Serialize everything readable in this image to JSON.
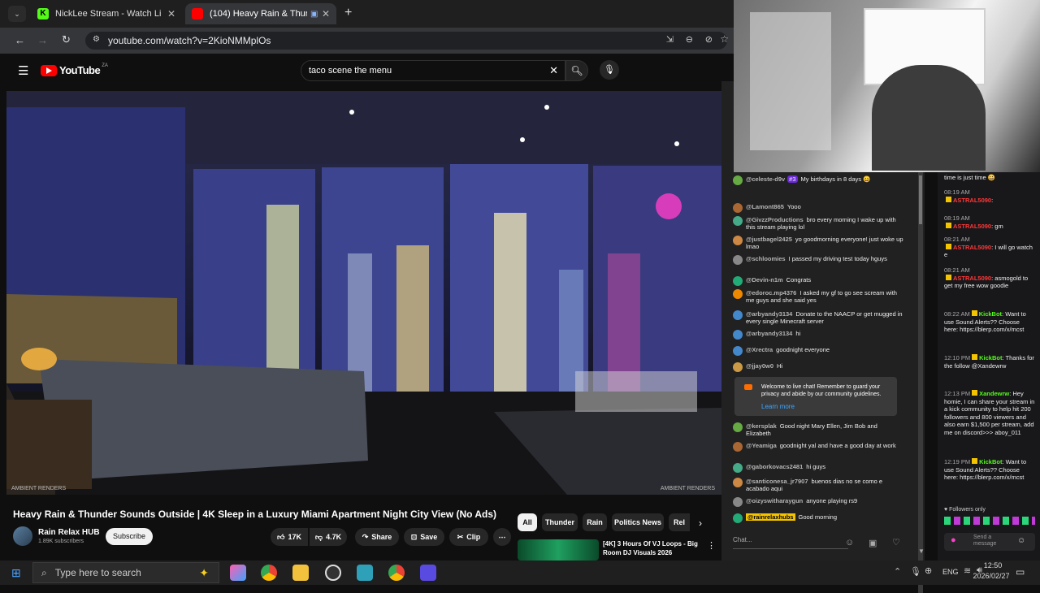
{
  "browser": {
    "tabs": [
      {
        "label": "NickLee Stream - Watch Live on"
      },
      {
        "label": "(104) Heavy Rain & Thunde"
      }
    ],
    "url": "youtube.com/watch?v=2KioNMMplOs"
  },
  "youtube": {
    "logo": "YouTube",
    "logo_sup": "ZA",
    "search_value": "taco scene the menu",
    "video_watermark_left": "AMBIENT RENDERS",
    "video_watermark_right": "AMBIENT RENDERS",
    "title": "Heavy Rain & Thunder Sounds Outside | 4K Sleep in a Luxury Miami Apartment Night City View (No Ads)",
    "channel": "Rain Relax HUB",
    "subscribers": "1.89K subscribers",
    "subscribe_label": "Subscribe",
    "likes": "17K",
    "dislikes": "4.7K",
    "share_label": "Share",
    "save_label": "Save",
    "clip_label": "Clip",
    "chips": [
      "All",
      "Thunder",
      "Rain",
      "Politics News",
      "Rel"
    ],
    "rec_title": "[4K] 3 Hours Of VJ Loops - Big Room DJ Visuals 2026"
  },
  "live_chat": {
    "messages": [
      {
        "user": "@celeste-d9v",
        "badge": "#3",
        "text": "My birthdays in 8 days 😀"
      },
      {
        "user": "@Lamont865",
        "text": "Yooo"
      },
      {
        "user": "@GivzzProductions",
        "text": "bro every morning I wake up with this stream playing lol"
      },
      {
        "user": "@justbagel2425",
        "text": "yo goodmorning everyone! just woke up lmao"
      },
      {
        "user": "@schloomies",
        "text": "I passed my driving test today hguys"
      },
      {
        "user": "@Devin-n1m",
        "text": "Congrats"
      },
      {
        "user": "@edoroc.mp4376",
        "text": "I asked my gf to go see scream with me guys and she said yes"
      },
      {
        "user": "@arbyandy3134",
        "text": "Donate to the NAACP or get mugged in every single Minecraft server"
      },
      {
        "user": "@arbyandy3134",
        "text": "hi"
      },
      {
        "user": "@Xrectra",
        "text": "goodnight everyone"
      },
      {
        "user": "@jjay0w0",
        "text": "Hi"
      }
    ],
    "notice_text": "Welcome to live chat! Remember to guard your privacy and abide by our community guidelines.",
    "notice_link": "Learn more",
    "messages2": [
      {
        "user": "@kersplak",
        "text": "Good night Mary Ellen, Jim Bob and Elizabeth"
      },
      {
        "user": "@Yeamiga",
        "text": "goodnight yal and have a good day at work"
      },
      {
        "user": "@gaborkovacs2481",
        "text": "hi guys"
      },
      {
        "user": "@santiconesa_jr7907",
        "text": "buenos dias no se como e acabado aqui"
      },
      {
        "user": "@oizyswitharaygun",
        "text": "anyone playing rs9"
      },
      {
        "user": "@rainrelaxhubs",
        "text": "Good morning"
      }
    ],
    "input_placeholder": "Chat..."
  },
  "kick_chat": {
    "top_text": "time is just time 😀",
    "messages": [
      {
        "time": "08:19 AM",
        "user": "ASTRAL5090",
        "text": ":"
      },
      {
        "time": "08:19 AM",
        "user": "ASTRAL5090",
        "text": ": gm"
      },
      {
        "time": "08:21 AM",
        "user": "ASTRAL5090",
        "text": ": I will go watch e"
      },
      {
        "time": "08:21 AM",
        "user": "ASTRAL5090",
        "text": ": asmogold to get my free wow goodie"
      },
      {
        "time": "08:22 AM",
        "user": "KickBot",
        "text": ": Want to use Sound Alerts?? Choose here: https://blerp.com/x/mcst"
      },
      {
        "time": "12:10 PM",
        "user": "KickBot",
        "text": ": Thanks for the follow @Xandewrw"
      },
      {
        "time": "12:13 PM",
        "user": "Xandewrw",
        "text": ": Hey homie, I can share your stream in a kick community to help hit 200 followers and 800 viewers and also earn $1,500 per stream, add me on discord>>> aboy_011"
      },
      {
        "time": "12:19 PM",
        "user": "KickBot",
        "text": ": Want to use Sound Alerts?? Choose here: https://blerp.com/x/mcst"
      }
    ],
    "followers_only": "Followers only",
    "send_placeholder": "Send a message"
  },
  "taskbar": {
    "search_placeholder": "Type here to search",
    "lang": "ENG",
    "time": "12:50",
    "date": "2026/02/27"
  }
}
